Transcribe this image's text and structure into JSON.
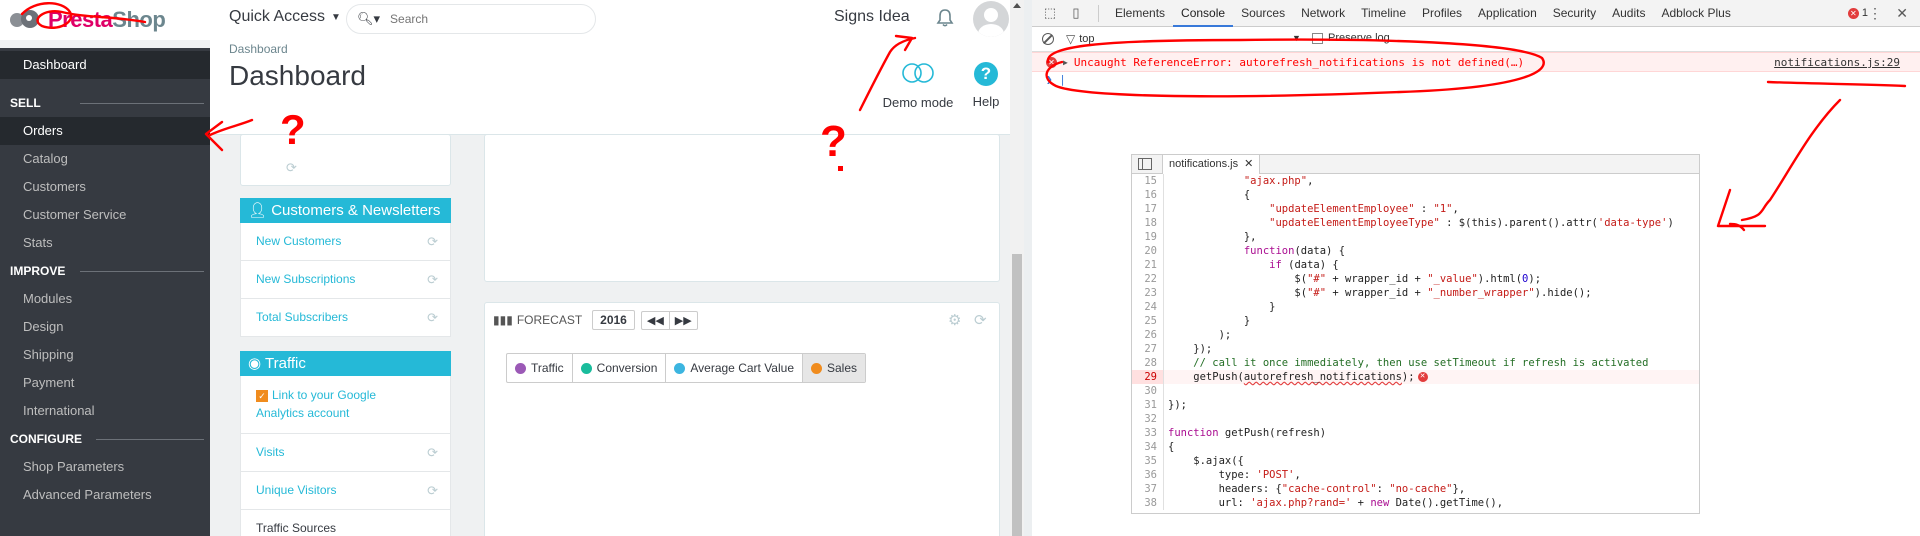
{
  "ps": {
    "logo": {
      "brand_a": "Presta",
      "brand_b": "Shop",
      "brand_color": "#df0067"
    },
    "header": {
      "quick_access": "Quick Access",
      "search_placeholder": "Search",
      "signs_idea": "Signs Idea"
    },
    "breadcrumb": "Dashboard",
    "page_title": "Dashboard",
    "demo_mode": "Demo mode",
    "help": "Help",
    "sidebar": {
      "dashboard": "Dashboard",
      "sections": [
        {
          "title": "SELL",
          "items": [
            "Orders",
            "Catalog",
            "Customers",
            "Customer Service",
            "Stats"
          ]
        },
        {
          "title": "IMPROVE",
          "items": [
            "Modules",
            "Design",
            "Shipping",
            "Payment",
            "International"
          ]
        },
        {
          "title": "CONFIGURE",
          "items": [
            "Shop Parameters",
            "Advanced Parameters"
          ]
        }
      ]
    },
    "widgets": {
      "customers_title": "Customers & Newsletters",
      "customers_items": [
        "New Customers",
        "New Subscriptions",
        "Total Subscribers"
      ],
      "traffic_title": "Traffic",
      "traffic_link": "Link to your Google Analytics account",
      "traffic_items": [
        "Visits",
        "Unique Visitors",
        "Traffic Sources"
      ]
    },
    "forecast": {
      "title": "FORECAST",
      "year": "2016",
      "tabs": [
        {
          "label": "Traffic",
          "color": "#9b59b6"
        },
        {
          "label": "Conversion",
          "color": "#1abc9c"
        },
        {
          "label": "Average Cart Value",
          "color": "#3cb5e0"
        },
        {
          "label": "Sales",
          "color": "#f08c1e"
        }
      ]
    },
    "accent_color": "#25b9d7"
  },
  "devtools": {
    "tabs": [
      "Elements",
      "Console",
      "Sources",
      "Network",
      "Timeline",
      "Profiles",
      "Application",
      "Security",
      "Audits",
      "Adblock Plus"
    ],
    "active_tab": "Console",
    "error_count": "1",
    "context": "top",
    "preserve_log": "Preserve log",
    "error_message": "Uncaught ReferenceError: autorefresh_notifications is not defined(…)",
    "error_source": "notifications.js:29",
    "source_file": "notifications.js",
    "code_lines": [
      {
        "n": "15",
        "t": "            \"ajax.php\","
      },
      {
        "n": "16",
        "t": "            {"
      },
      {
        "n": "17",
        "t": "                \"updateElementEmployee\" : \"1\","
      },
      {
        "n": "18",
        "t": "                \"updateElementEmployeeType\" : $(this).parent().attr('data-type')"
      },
      {
        "n": "19",
        "t": "            },"
      },
      {
        "n": "20",
        "t": "            function(data) {"
      },
      {
        "n": "21",
        "t": "                if (data) {"
      },
      {
        "n": "22",
        "t": "                    $(\"#\" + wrapper_id + \"_value\").html(0);"
      },
      {
        "n": "23",
        "t": "                    $(\"#\" + wrapper_id + \"_number_wrapper\").hide();"
      },
      {
        "n": "24",
        "t": "                }"
      },
      {
        "n": "25",
        "t": "            }"
      },
      {
        "n": "26",
        "t": "        );"
      },
      {
        "n": "27",
        "t": "    });"
      },
      {
        "n": "28",
        "t": "    // call it once immediately, then use setTimeout if refresh is activated"
      },
      {
        "n": "29",
        "t": "    getPush(autorefresh_notifications);"
      },
      {
        "n": "30",
        "t": ""
      },
      {
        "n": "31",
        "t": "});"
      },
      {
        "n": "32",
        "t": ""
      },
      {
        "n": "33",
        "t": "function getPush(refresh)"
      },
      {
        "n": "34",
        "t": "{"
      },
      {
        "n": "35",
        "t": "    $.ajax({"
      },
      {
        "n": "36",
        "t": "        type: 'POST',"
      },
      {
        "n": "37",
        "t": "        headers: {\"cache-control\": \"no-cache\"},"
      },
      {
        "n": "38",
        "t": "        url: 'ajax.php?rand=' + new Date().getTime(),"
      }
    ]
  },
  "annotations": {
    "marks": [
      "?",
      "?"
    ],
    "color": "#ff0000"
  }
}
